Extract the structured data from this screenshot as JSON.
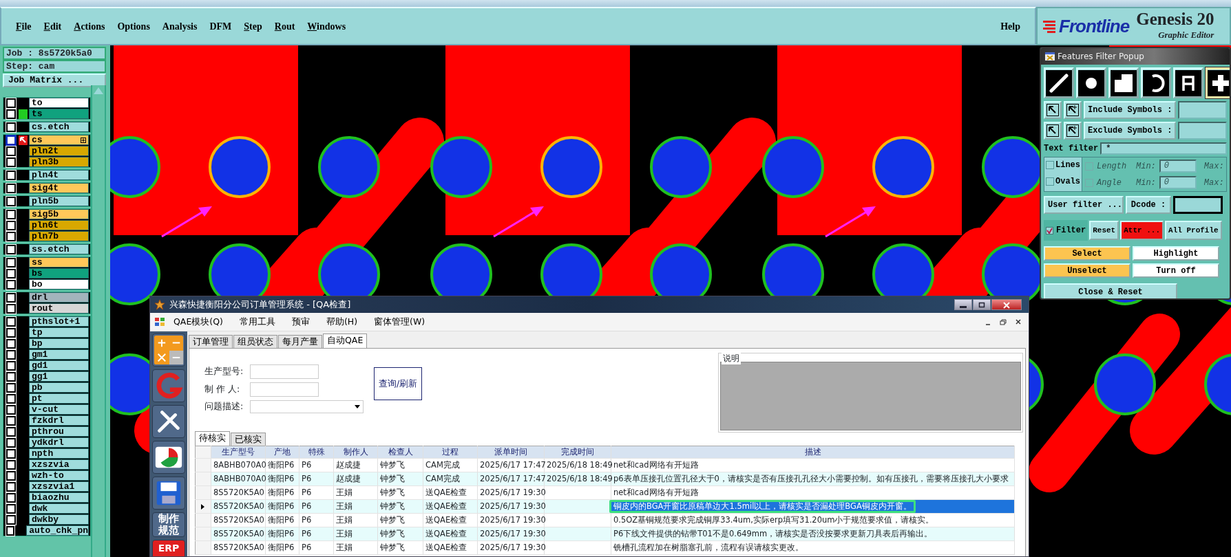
{
  "menu": {
    "items": [
      {
        "label": "File",
        "mnemonic": true
      },
      {
        "label": "Edit",
        "mnemonic": true
      },
      {
        "label": "Actions",
        "mnemonic": true
      },
      {
        "label": "Options",
        "mnemonic": false
      },
      {
        "label": "Analysis",
        "mnemonic": false
      },
      {
        "label": "DFM",
        "mnemonic": false
      },
      {
        "label": "Step",
        "mnemonic": true
      },
      {
        "label": "Rout",
        "mnemonic": true
      },
      {
        "label": "Windows",
        "mnemonic": true
      }
    ],
    "help": {
      "label": "Help",
      "mnemonic": false
    }
  },
  "brand": {
    "logo": "Frontline",
    "product": "Genesis 20",
    "subtitle": "Graphic Editor"
  },
  "job": {
    "job_label": "Job : 8s5720k5a0",
    "step_label": "Step: cam",
    "matrix_button": "Job Matrix ..."
  },
  "layer_groups": [
    {
      "layers": [
        {
          "name": "to",
          "color": "#ffffff",
          "work": false,
          "shown": false
        },
        {
          "name": "ts",
          "color": "#10a27e",
          "work": false,
          "shown": true
        }
      ]
    },
    {
      "layers": [
        {
          "name": "cs.etch",
          "color": "#9fdcdc",
          "work": false,
          "shown": false
        }
      ]
    },
    {
      "layers": [
        {
          "name": "cs",
          "color": "#ffc85a",
          "work": true,
          "shown": false
        },
        {
          "name": "pln2t",
          "color": "#d8a800",
          "work": false,
          "shown": false
        },
        {
          "name": "pln3b",
          "color": "#d8a800",
          "work": false,
          "shown": false
        }
      ]
    },
    {
      "layers": [
        {
          "name": "pln4t",
          "color": "#9fdcdc",
          "work": false,
          "shown": false
        }
      ]
    },
    {
      "layers": [
        {
          "name": "sig4t",
          "color": "#ffc85a",
          "work": false,
          "shown": false
        }
      ]
    },
    {
      "layers": [
        {
          "name": "pln5b",
          "color": "#9fdcdc",
          "work": false,
          "shown": false
        }
      ]
    },
    {
      "layers": [
        {
          "name": "sig5b",
          "color": "#ffc85a",
          "work": false,
          "shown": false
        },
        {
          "name": "pln6t",
          "color": "#d8a800",
          "work": false,
          "shown": false
        },
        {
          "name": "pln7b",
          "color": "#d8a800",
          "work": false,
          "shown": false
        }
      ]
    },
    {
      "layers": [
        {
          "name": "ss.etch",
          "color": "#9fdcdc",
          "work": false,
          "shown": false
        }
      ]
    },
    {
      "layers": [
        {
          "name": "ss",
          "color": "#ffc85a",
          "work": false,
          "shown": false
        },
        {
          "name": "bs",
          "color": "#10a27e",
          "work": false,
          "shown": false
        },
        {
          "name": "bo",
          "color": "#ffffff",
          "work": false,
          "shown": false
        }
      ]
    },
    {
      "layers": [
        {
          "name": "drl",
          "color": "#a3b4bc",
          "work": false,
          "shown": false
        },
        {
          "name": "rout",
          "color": "#d6d6d6",
          "work": false,
          "shown": false
        }
      ]
    },
    {
      "layers": [
        {
          "name": "pthslot+1",
          "color": "#9fdcdc",
          "work": false,
          "shown": false
        },
        {
          "name": "tp",
          "color": "#9fdcdc",
          "work": false,
          "shown": false
        },
        {
          "name": "bp",
          "color": "#9fdcdc",
          "work": false,
          "shown": false
        },
        {
          "name": "gm1",
          "color": "#9fdcdc",
          "work": false,
          "shown": false
        },
        {
          "name": "gd1",
          "color": "#9fdcdc",
          "work": false,
          "shown": false
        },
        {
          "name": "gg1",
          "color": "#9fdcdc",
          "work": false,
          "shown": false
        },
        {
          "name": "pb",
          "color": "#9fdcdc",
          "work": false,
          "shown": false
        },
        {
          "name": "pt",
          "color": "#9fdcdc",
          "work": false,
          "shown": false
        },
        {
          "name": "v-cut",
          "color": "#9fdcdc",
          "work": false,
          "shown": false
        },
        {
          "name": "fzkdrl",
          "color": "#9fdcdc",
          "work": false,
          "shown": false
        },
        {
          "name": "pthrou",
          "color": "#9fdcdc",
          "work": false,
          "shown": false
        },
        {
          "name": "ydkdrl",
          "color": "#9fdcdc",
          "work": false,
          "shown": false
        },
        {
          "name": "npth",
          "color": "#9fdcdc",
          "work": false,
          "shown": false
        },
        {
          "name": "xzszvia",
          "color": "#9fdcdc",
          "work": false,
          "shown": false
        },
        {
          "name": "wzh-to",
          "color": "#9fdcdc",
          "work": false,
          "shown": false
        },
        {
          "name": "xzszvia1",
          "color": "#9fdcdc",
          "work": false,
          "shown": false
        },
        {
          "name": "biaozhu",
          "color": "#9fdcdc",
          "work": false,
          "shown": false
        },
        {
          "name": "dwk",
          "color": "#9fdcdc",
          "work": false,
          "shown": false
        },
        {
          "name": "dwkby",
          "color": "#9fdcdc",
          "work": false,
          "shown": false
        },
        {
          "name": "auto_chk_pn",
          "color": "#9fdcdc",
          "work": false,
          "shown": false
        }
      ]
    }
  ],
  "filter_popup": {
    "title": "Features Filter Popup",
    "feature_types": [
      {
        "kind": "line",
        "selected": false
      },
      {
        "kind": "pad",
        "selected": false
      },
      {
        "kind": "surface",
        "selected": false
      },
      {
        "kind": "arc",
        "selected": false
      },
      {
        "kind": "text",
        "selected": false
      },
      {
        "kind": "all",
        "selected": true
      }
    ],
    "symbol_rows": [
      {
        "label": "Include Symbols :"
      },
      {
        "label": "Exclude Symbols :"
      }
    ],
    "text_filter": {
      "label": "Text filter",
      "value": "*"
    },
    "shape_rows": [
      {
        "label": "Lines",
        "checked": false,
        "sub_label": "Length",
        "sub_disabled": true,
        "min_label": "Min:",
        "min_value": "0",
        "max_label": "Max:"
      },
      {
        "label": "Ovals",
        "checked": false,
        "sub_label": "Angle",
        "sub_disabled": true,
        "min_label": "Min:",
        "min_value": "0",
        "max_label": "Max:"
      }
    ],
    "user_filter": "User filter ...",
    "dcode_label": "Dcode :",
    "filter_toggle": {
      "label": "Filter",
      "checked": true
    },
    "filter_buttons": [
      {
        "label": "Reset",
        "kind": "plain"
      },
      {
        "label": "Attr ...",
        "kind": "alert"
      },
      {
        "label": "All Profile",
        "kind": "plain"
      }
    ],
    "action_rows": [
      [
        {
          "label": "Select",
          "kind": "primary"
        },
        {
          "label": "Highlight",
          "kind": "secondary"
        }
      ],
      [
        {
          "label": "Unselect",
          "kind": "primary"
        },
        {
          "label": "Turn off",
          "kind": "secondary"
        }
      ]
    ],
    "close_button": "Close & Reset"
  },
  "qa_window": {
    "title": "兴森快捷衡阳分公司订单管理系统 - [QA检查]",
    "menu": [
      "QAE模块(Q)",
      "常用工具",
      "预审",
      "帮助(H)",
      "窗体管理(W)"
    ],
    "side_tools": [
      {
        "kind": "calculator"
      },
      {
        "kind": "logo"
      },
      {
        "kind": "tools"
      },
      {
        "kind": "chart"
      },
      {
        "kind": "save"
      },
      {
        "kind": "label",
        "label": "制作规范"
      },
      {
        "kind": "erp",
        "label": "ERP"
      }
    ],
    "tabs": [
      {
        "label": "订单管理",
        "selected": false
      },
      {
        "label": "组员状态",
        "selected": false
      },
      {
        "label": "每月产量",
        "selected": false
      },
      {
        "label": "自动QAE",
        "selected": true
      }
    ],
    "form": {
      "fields": [
        {
          "label": "生产型号:",
          "kind": "text"
        },
        {
          "label": "制 作 人:",
          "kind": "text"
        },
        {
          "label": "问题描述:",
          "kind": "combo"
        }
      ],
      "query_button": "查询/刷新",
      "notes_label": "说明"
    },
    "sub_tabs": [
      {
        "label": "待核实",
        "selected": true
      },
      {
        "label": "已核实",
        "selected": false
      }
    ],
    "table": {
      "columns": [
        "生产型号",
        "产地",
        "特殊",
        "制作人",
        "检查人",
        "过程",
        "派单时间",
        "完成时间",
        "描述"
      ],
      "rows": [
        {
          "job": "8ABHB070A0",
          "site": "衡阳P6",
          "special": "P6",
          "maker": "赵成捷",
          "checker": "钟梦飞",
          "process": "CAM完成",
          "dispatched": "2025/6/17 17:47",
          "completed": "2025/6/18 18:49",
          "description": "net和cad网络有开短路",
          "selected": false,
          "marked": false
        },
        {
          "job": "8ABHB070A0",
          "site": "衡阳P6",
          "special": "P6",
          "maker": "赵成捷",
          "checker": "钟梦飞",
          "process": "CAM完成",
          "dispatched": "2025/6/17 17:47",
          "completed": "2025/6/18 18:49",
          "description": "p6表单压接孔位置孔径大于0，请核实是否有压接孔孔径大小需要控制。如有压接孔，需要将压接孔大小要求",
          "selected": false,
          "marked": false
        },
        {
          "job": "8S5720K5A0",
          "site": "衡阳P6",
          "special": "P6",
          "maker": "王娟",
          "checker": "钟梦飞",
          "process": "送QAE检查",
          "dispatched": "2025/6/17 19:30",
          "description": "net和cad网络有开短路",
          "selected": false,
          "marked": false
        },
        {
          "job": "8S5720K5A0",
          "site": "衡阳P6",
          "special": "P6",
          "maker": "王娟",
          "checker": "钟梦飞",
          "process": "送QAE检查",
          "dispatched": "2025/6/17 19:30",
          "description": "铜皮内的BGA开窗比原稿单边大1.5mil以上，请核实是否漏处理BGA铜皮内开窗。",
          "selected": true,
          "marked": true
        },
        {
          "job": "8S5720K5A0",
          "site": "衡阳P6",
          "special": "P6",
          "maker": "王娟",
          "checker": "钟梦飞",
          "process": "送QAE检查",
          "dispatched": "2025/6/17 19:30",
          "description": "0.5OZ基铜规范要求完成铜厚33.4um,实际erp填写31.20um小于规范要求值，请核实。",
          "selected": false,
          "marked": false
        },
        {
          "job": "8S5720K5A0",
          "site": "衡阳P6",
          "special": "P6",
          "maker": "王娟",
          "checker": "钟梦飞",
          "process": "送QAE检查",
          "dispatched": "2025/6/17 19:30",
          "description": "P6下线文件提供的钻带T01不是0.649mm，请核实是否没按要求更新刀具表后再输出。",
          "selected": false,
          "marked": false
        },
        {
          "job": "8S5720K5A0",
          "site": "衡阳P6",
          "special": "P6",
          "maker": "王娟",
          "checker": "钟梦飞",
          "process": "送QAE检查",
          "dispatched": "2025/6/17 19:30",
          "description": "铣槽孔流程加在树脂塞孔前，流程有误请核实更改。",
          "selected": false,
          "marked": false
        }
      ]
    }
  }
}
